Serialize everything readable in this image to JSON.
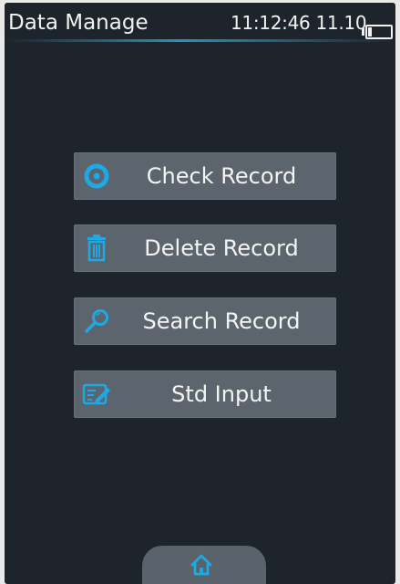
{
  "header": {
    "title": "Data Manage",
    "time": "11:12:46 11.10",
    "battery_level": 0.15
  },
  "menu": [
    {
      "label": "Check Record",
      "icon": "eye-icon"
    },
    {
      "label": "Delete Record",
      "icon": "trash-icon"
    },
    {
      "label": "Search Record",
      "icon": "search-icon"
    },
    {
      "label": "Std Input",
      "icon": "edit-icon"
    }
  ],
  "footer": {
    "home_icon": "home-icon"
  },
  "colors": {
    "accent": "#1ca9e6",
    "screen_bg": "#1d242c",
    "button_bg": "#5c656d",
    "text": "#f4f4f4"
  }
}
